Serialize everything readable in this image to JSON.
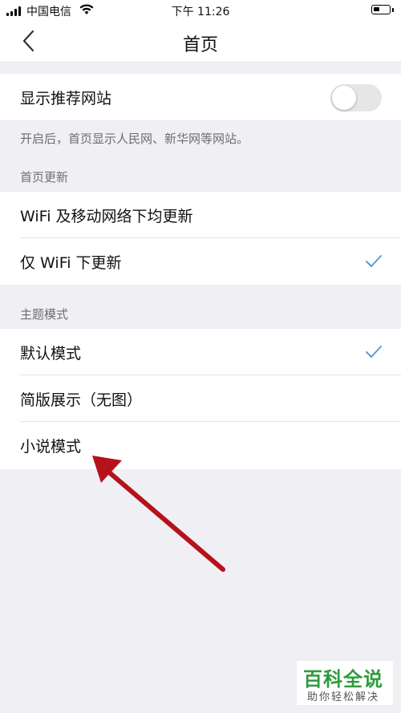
{
  "status_bar": {
    "carrier": "中国电信",
    "time": "下午 11:26"
  },
  "nav": {
    "title": "首页"
  },
  "recommend": {
    "label": "显示推荐网站",
    "toggle_on": false,
    "note": "开启后，首页显示人民网、新华网等网站。"
  },
  "update_section": {
    "header": "首页更新",
    "options": [
      {
        "label": "WiFi 及移动网络下均更新",
        "selected": false
      },
      {
        "label": "仅 WiFi 下更新",
        "selected": true
      }
    ]
  },
  "theme_section": {
    "header": "主题模式",
    "options": [
      {
        "label": "默认模式",
        "selected": true
      },
      {
        "label": "简版展示（无图）",
        "selected": false
      },
      {
        "label": "小说模式",
        "selected": false
      }
    ]
  },
  "colors": {
    "accent_check": "#5a9ad6",
    "annotation_arrow": "#b5121b",
    "watermark_green": "#2e9b3c"
  },
  "icons": [
    "signal-icon",
    "wifi-icon",
    "battery-icon",
    "back-chevron-icon",
    "checkmark-icon",
    "annotation-arrow"
  ],
  "watermark": {
    "title": "百科全说",
    "subtitle": "助你轻松解决"
  }
}
